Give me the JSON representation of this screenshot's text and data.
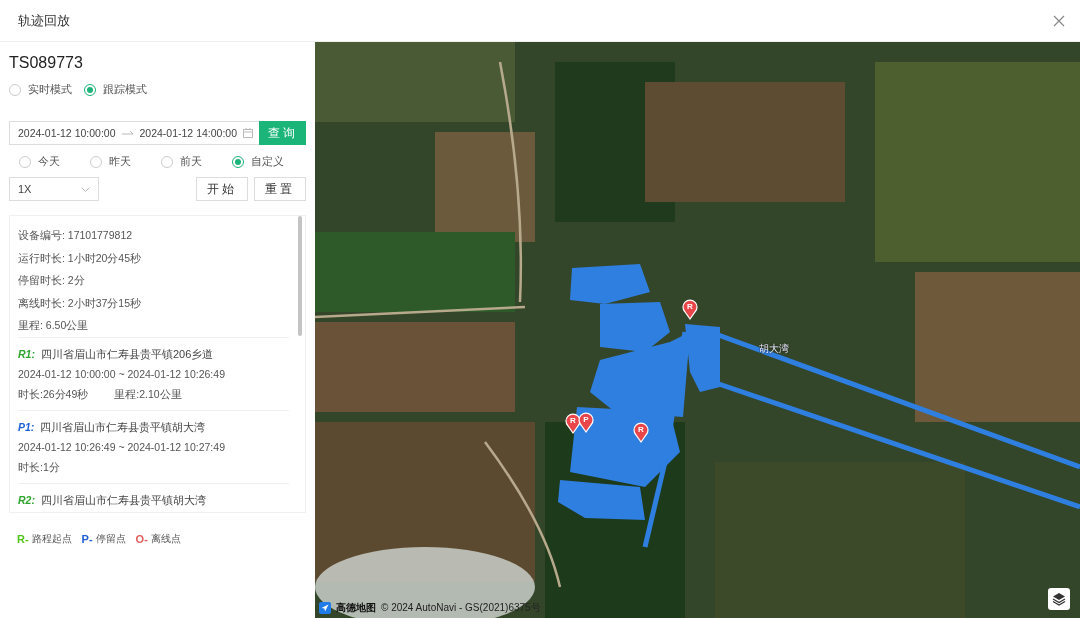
{
  "window": {
    "title": "轨迹回放"
  },
  "device": {
    "code": "TS089773"
  },
  "modes": [
    {
      "label": "实时模式",
      "selected": false
    },
    {
      "label": "跟踪模式",
      "selected": true
    }
  ],
  "date_range": {
    "start": "2024-01-12 10:00:00",
    "end": "2024-01-12 14:00:00"
  },
  "query_button": "查询",
  "quick_ranges": [
    {
      "label": "今天",
      "selected": false
    },
    {
      "label": "昨天",
      "selected": false
    },
    {
      "label": "前天",
      "selected": false
    },
    {
      "label": "自定义",
      "selected": true
    }
  ],
  "speed": {
    "value": "1X"
  },
  "actions": [
    "开始",
    "重置"
  ],
  "summary": [
    "设备编号: 17101779812",
    "运行时长: 1小时20分45秒",
    "停留时长: 2分",
    "离线时长: 2小时37分15秒",
    "里程: 6.50公里"
  ],
  "segments": [
    {
      "tag": "R1:",
      "kind": "route",
      "address": "四川省眉山市仁寿县贵平镇206乡道",
      "time": "2024-01-12 10:00:00 ~ 2024-01-12 10:26:49",
      "duration": "时长:26分49秒",
      "mileage": "里程:2.10公里"
    },
    {
      "tag": "P1:",
      "kind": "stop",
      "address": "四川省眉山市仁寿县贵平镇胡大湾",
      "time": "2024-01-12 10:26:49 ~ 2024-01-12 10:27:49",
      "duration": "时长:1分"
    },
    {
      "tag": "R2:",
      "kind": "route",
      "address": "四川省眉山市仁寿县贵平镇胡大湾"
    }
  ],
  "legend": [
    {
      "key": "R-",
      "label": "路程起点",
      "color": "#52c41a"
    },
    {
      "key": "P-",
      "label": "停留点",
      "color": "#1f5fd6"
    },
    {
      "key": "O-",
      "label": "离线点",
      "color": "#e05a5a"
    }
  ],
  "map": {
    "place_label": "胡大湾",
    "markers": [
      {
        "label": "R"
      },
      {
        "label": "R"
      },
      {
        "label": "P"
      },
      {
        "label": "R"
      }
    ],
    "provider": "高德地图",
    "copyright": "© 2024 AutoNavi - GS(2021)6375号"
  }
}
